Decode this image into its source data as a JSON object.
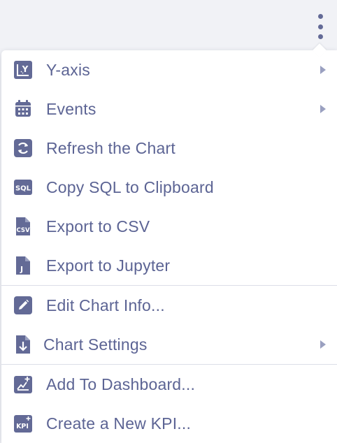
{
  "colors": {
    "icon": "#636a96",
    "text": "#5c6494",
    "arrow": "#9aa0c0",
    "background": "#f1f2f6",
    "menu": "#ffffff",
    "divider": "#dcdee8"
  },
  "kebab_icon": "more-vertical-icon",
  "menu": {
    "groups": [
      [
        {
          "label": "Y-axis",
          "icon": "y-axis-icon",
          "submenu": true
        },
        {
          "label": "Events",
          "icon": "calendar-icon",
          "submenu": true
        },
        {
          "label": "Refresh the Chart",
          "icon": "refresh-icon",
          "submenu": false
        },
        {
          "label": "Copy SQL to Clipboard",
          "icon": "sql-icon",
          "submenu": false
        },
        {
          "label": "Export to CSV",
          "icon": "csv-file-icon",
          "submenu": false
        },
        {
          "label": "Export to Jupyter",
          "icon": "jupyter-file-icon",
          "submenu": false
        }
      ],
      [
        {
          "label": "Edit Chart Info...",
          "icon": "pencil-icon",
          "submenu": false
        },
        {
          "label": "Chart Settings",
          "icon": "file-download-icon",
          "submenu": true
        }
      ],
      [
        {
          "label": "Add To Dashboard...",
          "icon": "add-chart-icon",
          "submenu": false
        },
        {
          "label": "Create a New KPI...",
          "icon": "kpi-icon",
          "submenu": false
        }
      ]
    ]
  }
}
